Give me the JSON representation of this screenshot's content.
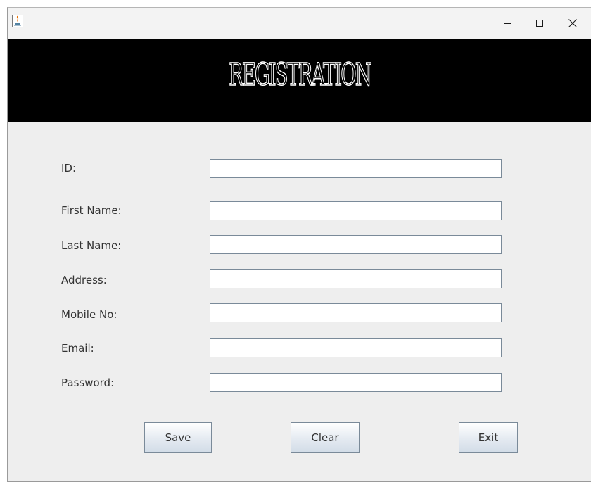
{
  "window": {
    "app_icon": "java-cup-icon",
    "controls": {
      "minimize": "−",
      "maximize": "☐",
      "close": "✕"
    }
  },
  "header": {
    "title": "REGISTRATION"
  },
  "form": {
    "fields": [
      {
        "label": "ID:",
        "value": ""
      },
      {
        "label": "First Name:",
        "value": ""
      },
      {
        "label": "Last Name:",
        "value": ""
      },
      {
        "label": "Address:",
        "value": ""
      },
      {
        "label": "Mobile No:",
        "value": ""
      },
      {
        "label": "Email:",
        "value": ""
      },
      {
        "label": "Password:",
        "value": ""
      }
    ]
  },
  "buttons": {
    "save": "Save",
    "clear": "Clear",
    "exit": "Exit"
  },
  "colors": {
    "banner_bg": "#000000",
    "window_bg": "#eeeeee",
    "input_border": "#7a8a99"
  }
}
